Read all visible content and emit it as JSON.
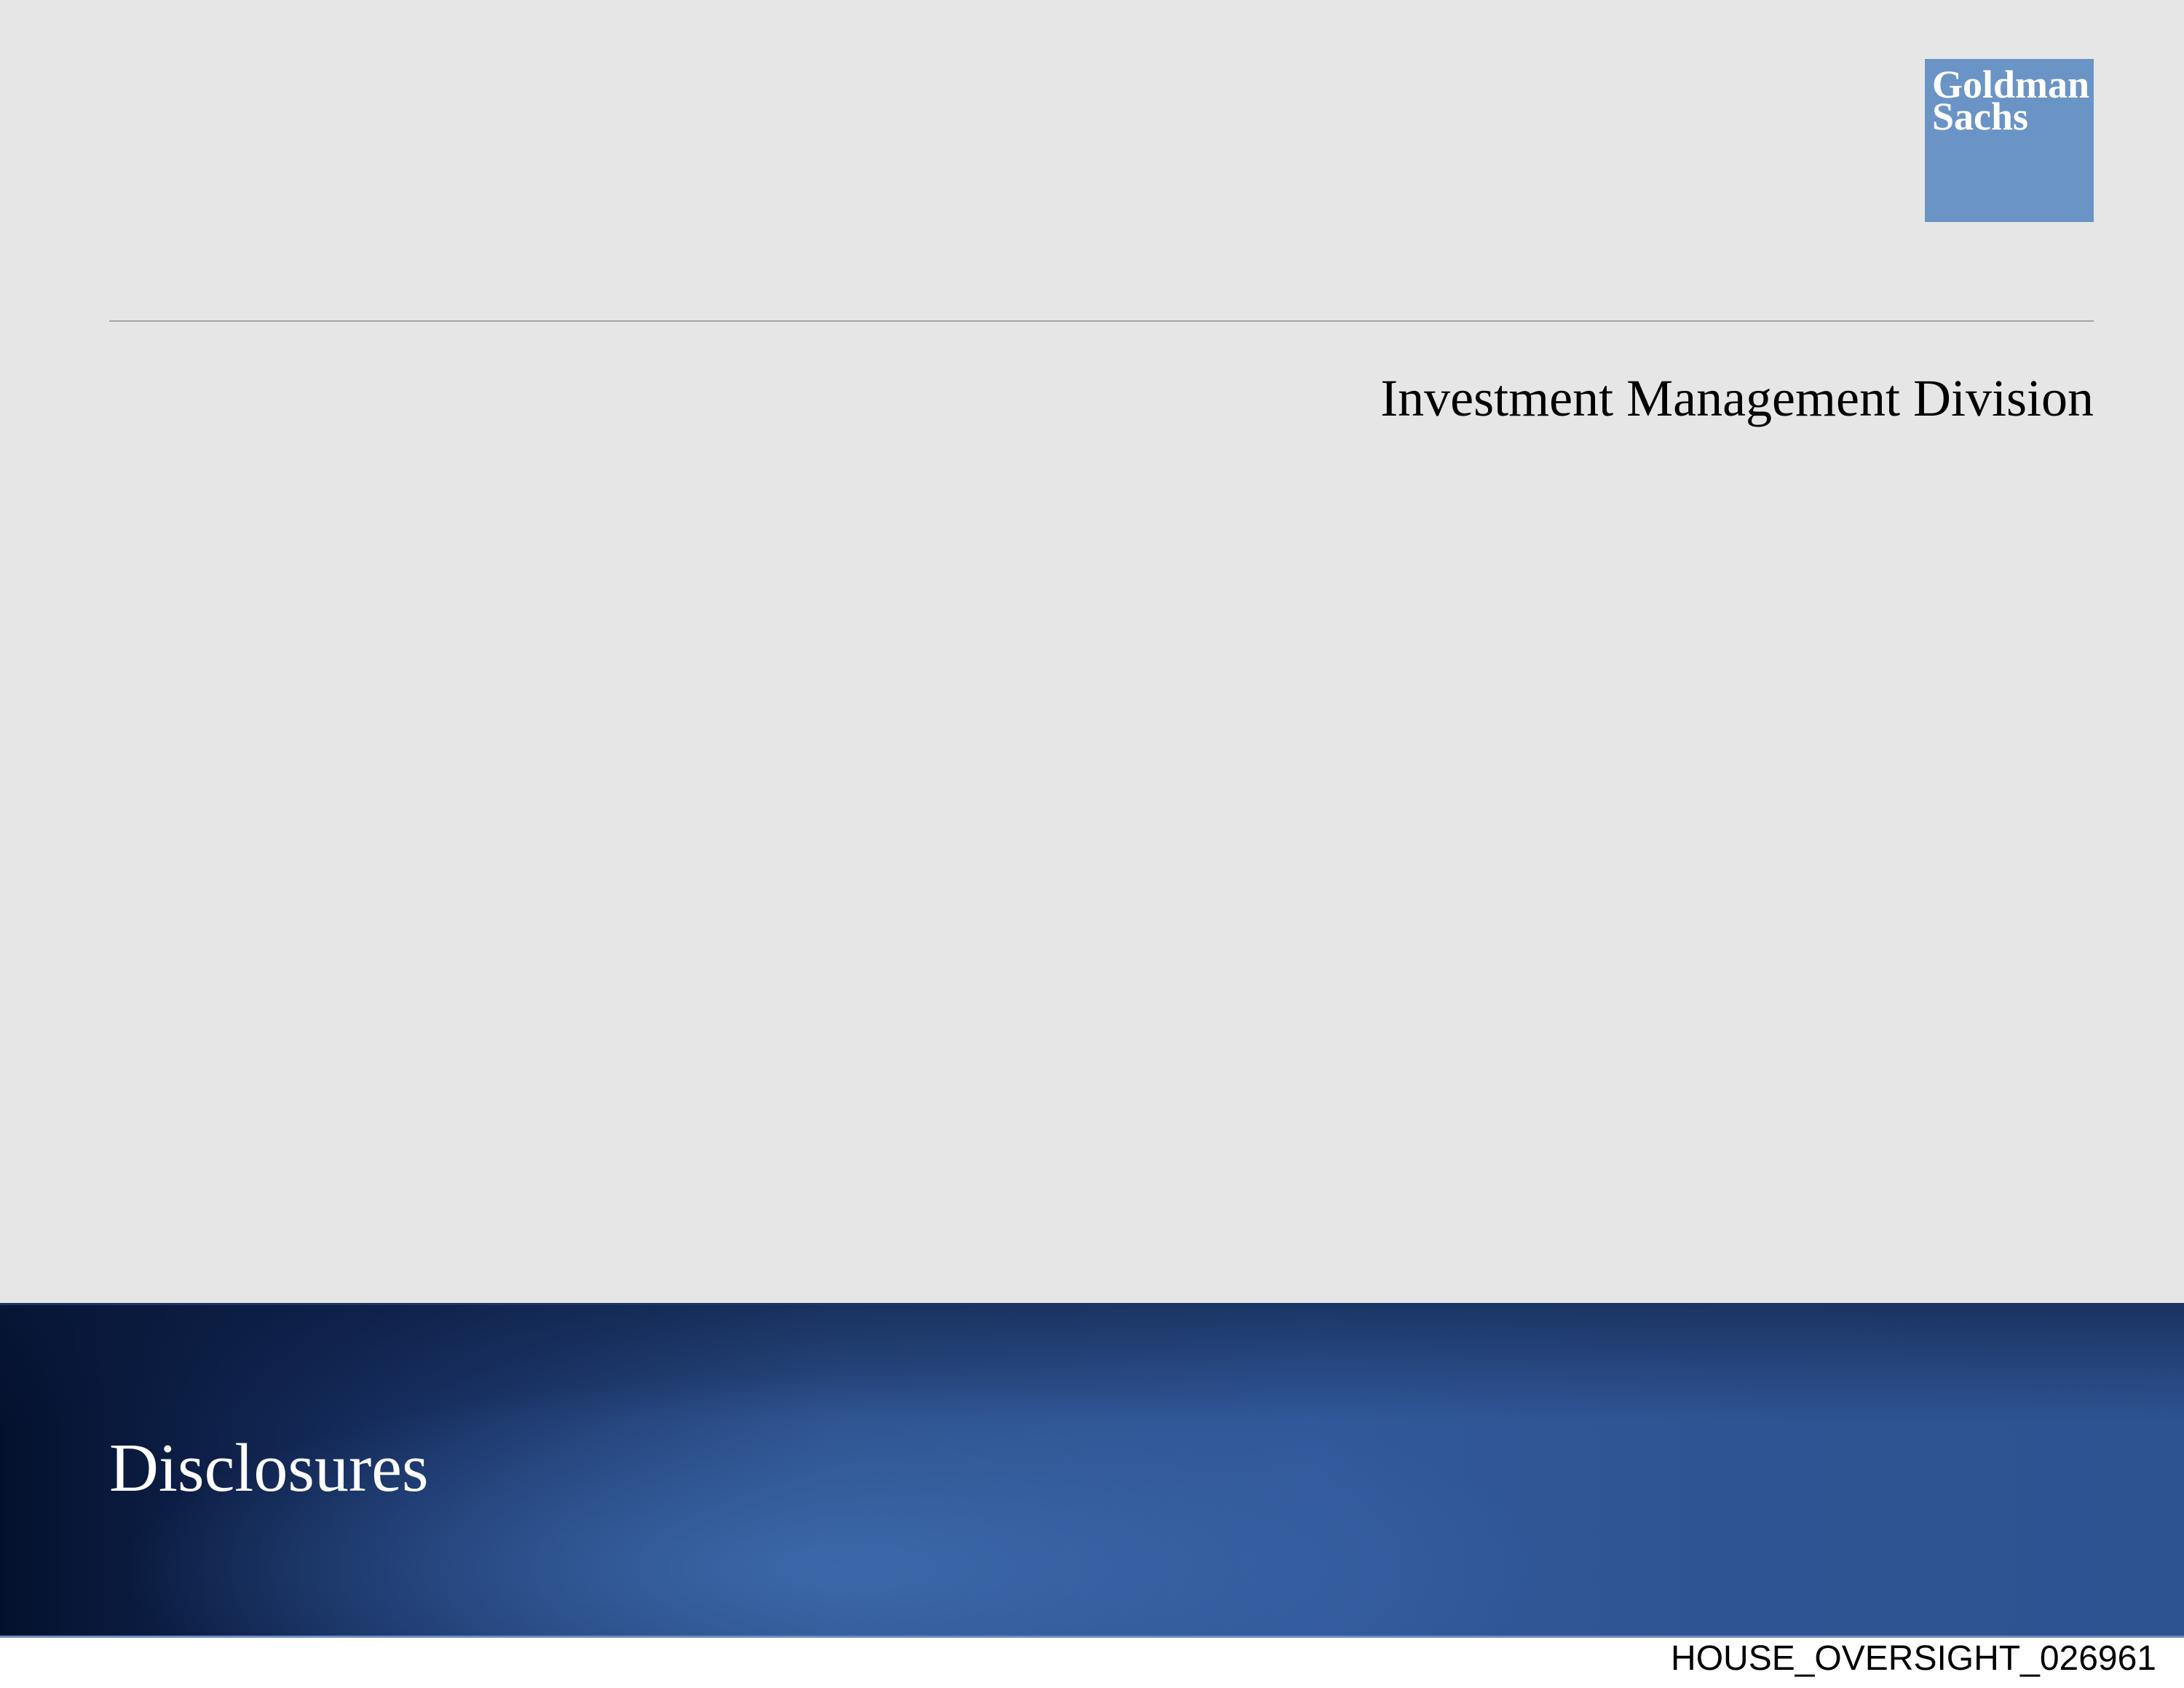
{
  "logo": {
    "line1": "Goldman",
    "line2": "Sachs",
    "color": "#6b94c6"
  },
  "header": {
    "division": "Investment Management Division"
  },
  "banner": {
    "title": "Disclosures",
    "color_dark": "#04112e",
    "color_light": "#31589a"
  },
  "footer": {
    "bates_number": "HOUSE_OVERSIGHT_026961"
  }
}
